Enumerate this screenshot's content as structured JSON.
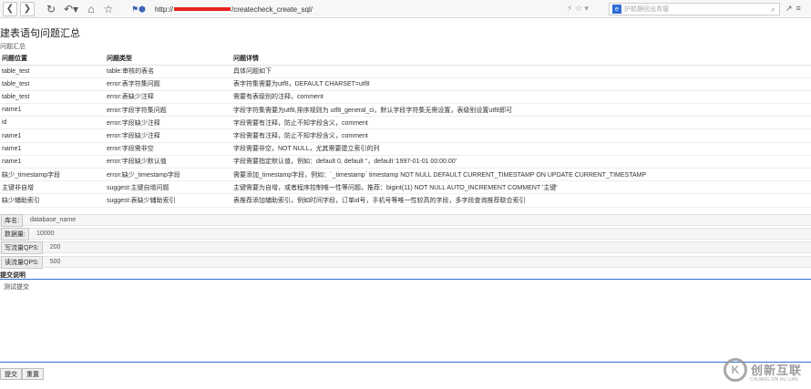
{
  "browser": {
    "url_prefix": "http://",
    "url_suffix": "/createcheck_create_sql/",
    "search_placeholder": "护航静回出青瘤",
    "icons": [
      "back-icon",
      "forward-icon",
      "refresh-icon",
      "undo-icon",
      "home-icon",
      "star-icon",
      "shield-icon"
    ]
  },
  "page": {
    "title": "建表语句问题汇总",
    "subtitle": "问题汇总"
  },
  "table": {
    "headers": [
      "问题位置",
      "问题类型",
      "问题详情"
    ],
    "rows": [
      [
        "table_test",
        "table:审核的表名",
        "具体问题如下"
      ],
      [
        "table_test",
        "error:表字符集问题",
        "表字符集需要为utf8，DEFAULT CHARSET=utf8"
      ],
      [
        "table_test",
        "error:表缺少注释",
        "需要有表级别的注释，comment"
      ],
      [
        "name1",
        "error:字段字符集问题",
        "字段字符集需要为utf8,排序规则为 utf8_general_ci，默认字段字符集无需设置，表级别设置utf8即可"
      ],
      [
        "id",
        "error:字段缺少注释",
        "字段需要有注释，防止不知字段含义，comment"
      ],
      [
        "name1",
        "error:字段缺少注释",
        "字段需要有注释，防止不知字段含义，comment"
      ],
      [
        "name1",
        "error:字段需非空",
        "字段需要非空，NOT NULL，尤其需要建立索引的列"
      ],
      [
        "name1",
        "error:字段缺少默认值",
        "字段需要指定默认值，例如：default 0, default ''，default '1997-01-01 00:00:00'"
      ],
      [
        "缺少_timestamp字段",
        "error:缺少_timestamp字段",
        "需要添加_timestamp字段，例如：`_timestamp` timestamp NOT NULL DEFAULT CURRENT_TIMESTAMP ON UPDATE CURRENT_TIMESTAMP"
      ],
      [
        "主键非自增",
        "suggest:主键自增问题",
        "主键需要为自增，或者程序控制唯一性等问题，推荐：bigint(11) NOT NULL AUTO_INCREMENT COMMENT '主键'"
      ],
      [
        "缺少辅助索引",
        "suggest:表缺少辅助索引",
        "表推荐添加辅助索引，例如时间字段，订单id号，手机号等唯一性较高的字段，多字段查询推荐联合索引"
      ]
    ]
  },
  "form": {
    "db_label": "库名:",
    "db_value": "database_name",
    "rows_label": "数据量:",
    "rows_value": "10000",
    "write_qps_label": "写流量QPS:",
    "write_qps_value": "200",
    "read_qps_label": "读流量QPS:",
    "read_qps_value": "500",
    "desc_label": "提交说明",
    "desc_value": "测试提交",
    "submit_label": "提交",
    "reset_label": "重置"
  },
  "watermark": {
    "mark": "K",
    "text": "创新互联",
    "sub": "CHUANG XIN HU LIAN"
  }
}
